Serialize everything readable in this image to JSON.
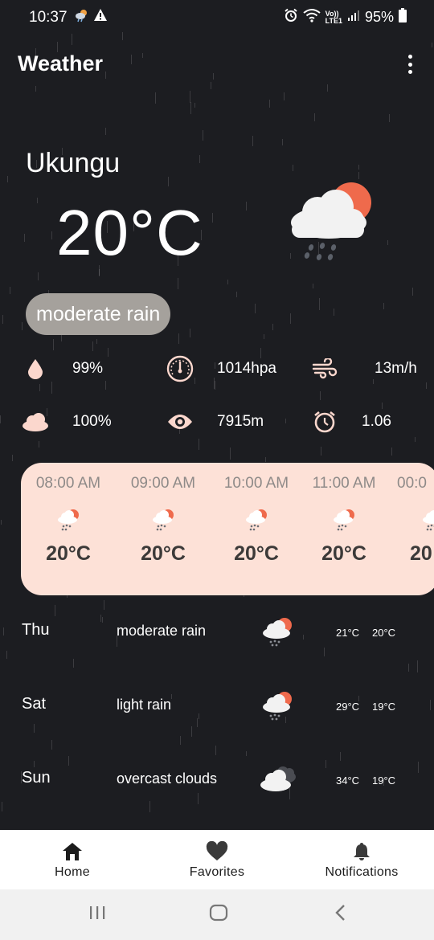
{
  "status_bar": {
    "time": "10:37",
    "network": "LTE1",
    "volte": "Vo))",
    "battery": "95%"
  },
  "app_bar": {
    "title": "Weather",
    "menu_icon": "more-vert-icon"
  },
  "current": {
    "city": "Ukungu",
    "temperature": "20°C",
    "condition": "moderate rain",
    "icon": "rain-cloud-sun-icon"
  },
  "stats": {
    "humidity": "99%",
    "pressure": "1014hpa",
    "wind": "13m/h",
    "clouds": "100%",
    "visibility": "7915m",
    "uv": "1.06"
  },
  "hourly": [
    {
      "time": "08:00 AM",
      "temp": "20°C",
      "icon": "rain-cloud-sun-icon"
    },
    {
      "time": "09:00 AM",
      "temp": "20°C",
      "icon": "rain-cloud-sun-icon"
    },
    {
      "time": "10:00 AM",
      "temp": "20°C",
      "icon": "rain-cloud-sun-icon"
    },
    {
      "time": "11:00 AM",
      "temp": "20°C",
      "icon": "rain-cloud-sun-icon"
    },
    {
      "time": "00:0",
      "temp": "20",
      "icon": "rain-cloud-sun-icon"
    }
  ],
  "daily": [
    {
      "day": "Thu",
      "desc": "moderate rain",
      "hi": "21°C",
      "lo": "20°C",
      "icon": "rain-cloud-sun-icon"
    },
    {
      "day": "Sat",
      "desc": "light rain",
      "hi": "29°C",
      "lo": "19°C",
      "icon": "rain-cloud-sun-icon"
    },
    {
      "day": "Sun",
      "desc": "overcast clouds",
      "hi": "34°C",
      "lo": "19°C",
      "icon": "overcast-clouds-icon"
    }
  ],
  "bottom_nav": {
    "home": "Home",
    "favorites": "Favorites",
    "notifications": "Notifications"
  },
  "colors": {
    "background": "#1c1d21",
    "accent": "#ef6a4c",
    "card": "#fde1d7",
    "chip": "#a5a19c"
  }
}
